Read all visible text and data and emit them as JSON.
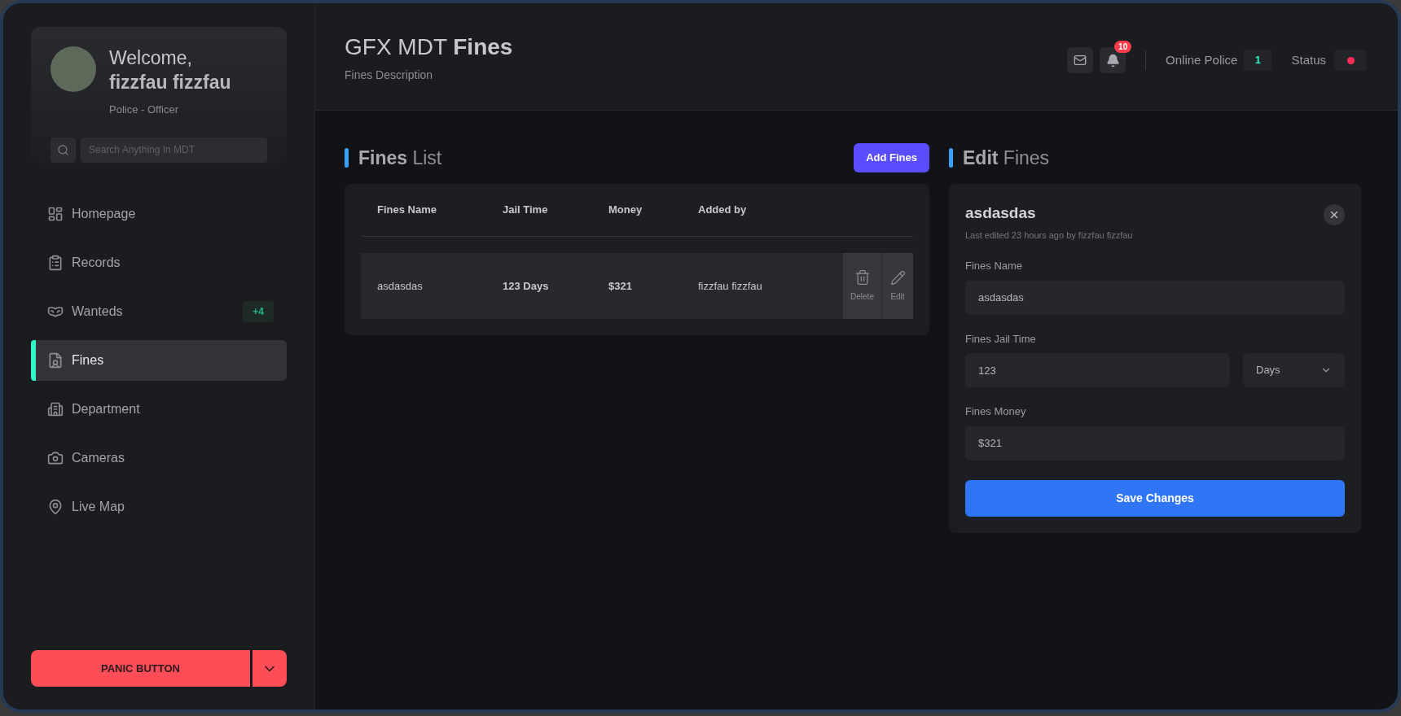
{
  "sidebar": {
    "profile": {
      "greeting": "Welcome,",
      "name": "fizzfau fizzfau",
      "role": "Police - Officer"
    },
    "search": {
      "placeholder": "Search Anything In MDT"
    },
    "items": [
      {
        "label": "Homepage",
        "selected": false
      },
      {
        "label": "Records",
        "selected": false
      },
      {
        "label": "Wanteds",
        "selected": false,
        "badge": "+4"
      },
      {
        "label": "Fines",
        "selected": true
      },
      {
        "label": "Department",
        "selected": false
      },
      {
        "label": "Cameras",
        "selected": false
      },
      {
        "label": "Live Map",
        "selected": false
      }
    ],
    "panic_button": "PANIC BUTTON"
  },
  "header": {
    "title": "GFX MDT **Fines**",
    "subtitle": "Fines Description",
    "notifications": "10",
    "online_label": "Online Police",
    "online_count": "1",
    "status": {
      "label": "Status",
      "color": "#ff2d55"
    }
  },
  "fines_list": {
    "title": "**Fines** List",
    "add_button": "Add Fines",
    "columns": [
      "Fines Name",
      "Jail Time",
      "Money",
      "Added by"
    ],
    "rows": [
      {
        "cells": [
          "asdasdas",
          "123 Days",
          "$321",
          "fizzfau fizzfau"
        ],
        "actions": [
          "Delete",
          "Edit"
        ]
      }
    ]
  },
  "edit": {
    "title": "**Edit** Fines",
    "name": "asdasdas",
    "meta": "Last edited 23 hours ago by fizzfau fizzfau",
    "fields": [
      {
        "kind": "text",
        "label": "Fines Name",
        "value": "asdasdas"
      },
      {
        "kind": "duration",
        "label": "Fines Jail Time",
        "value": "123",
        "unit": "Days"
      },
      {
        "kind": "text",
        "label": "Fines Money",
        "value": "$321"
      }
    ],
    "save_button": "Save Changes"
  }
}
